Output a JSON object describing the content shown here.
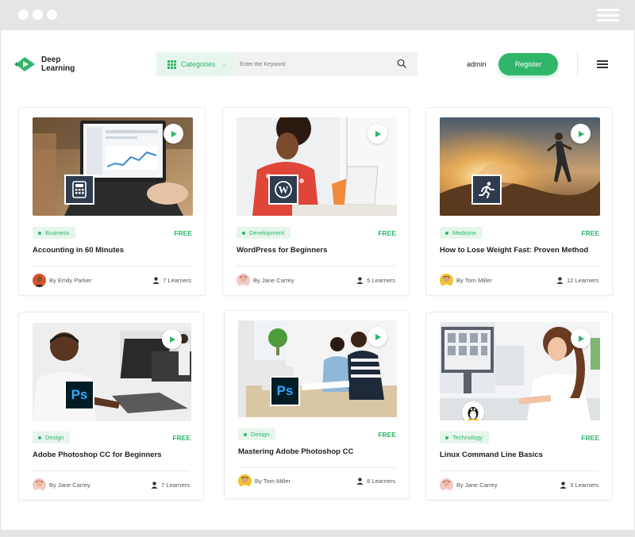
{
  "brand": {
    "line1": "Deep",
    "line2": "Learning"
  },
  "search": {
    "categories_label": "Categories",
    "placeholder": "Enter the Keyword"
  },
  "header": {
    "user": "admin",
    "register_label": "Register"
  },
  "colors": {
    "accent": "#2fb66a",
    "accent_light": "#e6f6ec",
    "chrome": "#e5e5e5"
  },
  "courses": [
    {
      "category": "Business",
      "price": "FREE",
      "title": "Accounting in 60 Minutes",
      "author": "By Emily Parker",
      "learners": "7 Learners",
      "icon": "calculator-icon"
    },
    {
      "category": "Development",
      "price": "FREE",
      "title": "WordPress for Beginners",
      "author": "By Jane Carrey",
      "learners": "5 Learners",
      "icon": "wordpress-icon"
    },
    {
      "category": "Medicine",
      "price": "FREE",
      "title": "How to Lose Weight Fast: Proven Method",
      "author": "By Tom Miller",
      "learners": "12 Learners",
      "icon": "running-icon"
    },
    {
      "category": "Design",
      "price": "FREE",
      "title": "Adobe Photoshop CC for Beginners",
      "author": "By Jane Carrey",
      "learners": "7 Learners",
      "icon": "photoshop-icon"
    },
    {
      "category": "Design",
      "price": "FREE",
      "title": "Mastering Adobe Photoshop CC",
      "author": "By Tom Miller",
      "learners": "8 Learners",
      "icon": "photoshop-icon"
    },
    {
      "category": "Technology",
      "price": "FREE",
      "title": "Linux Command Line Basics",
      "author": "By Jane Carrey",
      "learners": "3 Learners",
      "icon": "linux-penguin-icon"
    }
  ]
}
